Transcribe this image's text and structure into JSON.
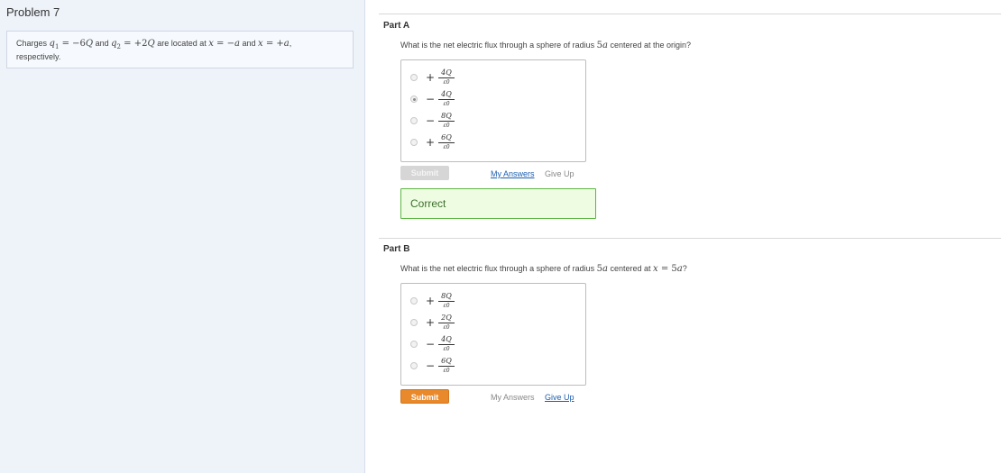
{
  "problem": {
    "title": "Problem 7",
    "statement": {
      "t1": "Charges ",
      "q1": "q",
      "q1_sub": "1",
      "eq1": " = −6",
      "Q1": "Q",
      "t2": " and ",
      "q2": "q",
      "q2_sub": "2",
      "eq2": " = +2",
      "Q2": "Q",
      "t3": " are located at ",
      "x1": "x",
      "eq3": " = −",
      "a1": "a",
      "t4": " and ",
      "x2": "x",
      "eq4": " = +",
      "a2": "a",
      "t5": ",",
      "t6": "respectively."
    }
  },
  "partA": {
    "title": "Part A",
    "question": {
      "q_pre": "What is the net electric flux through a sphere of radius ",
      "r_num": "5",
      "r_var": "a",
      "q_post": " centered at the origin?"
    },
    "choices": [
      {
        "sign": "+",
        "num": "4Q",
        "den": "ε0",
        "selected": false
      },
      {
        "sign": "−",
        "num": "4Q",
        "den": "ε0",
        "selected": true
      },
      {
        "sign": "−",
        "num": "8Q",
        "den": "ε0",
        "selected": false
      },
      {
        "sign": "+",
        "num": "6Q",
        "den": "ε0",
        "selected": false
      }
    ],
    "submit_label": "Submit",
    "my_answers_label": "My Answers",
    "give_up_label": "Give Up",
    "feedback": "Correct"
  },
  "partB": {
    "title": "Part B",
    "question": {
      "q_pre": "What is the net electric flux through a sphere of radius ",
      "r_num": "5",
      "r_var": "a",
      "q_mid": " centered at ",
      "x_var": "x",
      "x_eq": " = 5",
      "x_a": "a",
      "q_post": "?"
    },
    "choices": [
      {
        "sign": "+",
        "num": "8Q",
        "den": "ε0",
        "selected": false
      },
      {
        "sign": "+",
        "num": "2Q",
        "den": "ε0",
        "selected": false
      },
      {
        "sign": "−",
        "num": "4Q",
        "den": "ε0",
        "selected": false
      },
      {
        "sign": "−",
        "num": "6Q",
        "den": "ε0",
        "selected": false
      }
    ],
    "submit_label": "Submit",
    "my_answers_label": "My Answers",
    "give_up_label": "Give Up"
  },
  "colors": {
    "accent_submit": "#e8892b",
    "correct_border": "#5cb544",
    "correct_bg": "#eefde2",
    "link": "#1d5fae"
  }
}
